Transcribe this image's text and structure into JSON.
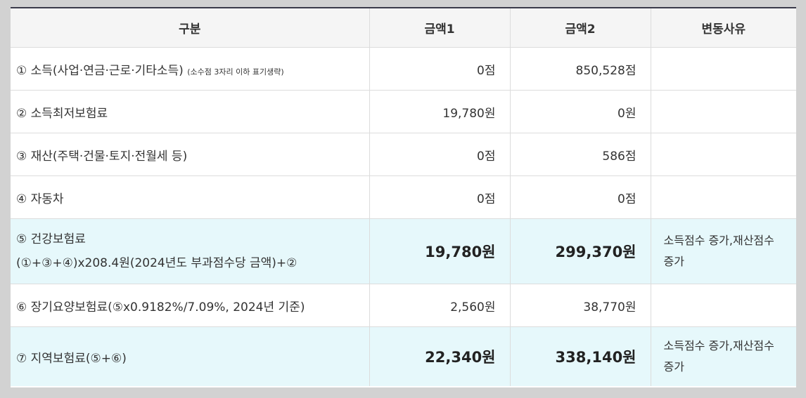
{
  "header": {
    "category": "구분",
    "amount1": "금액1",
    "amount2": "금액2",
    "reason": "변동사유"
  },
  "rows": [
    {
      "label": "① 소득(사업·연금·근로·기타소득)",
      "note": "(소수점 3자리 이하 표기생략)",
      "amount1": "0점",
      "amount2": "850,528점",
      "reason": ""
    },
    {
      "label": "② 소득최저보험료",
      "amount1": "19,780원",
      "amount2": "0원",
      "reason": ""
    },
    {
      "label": "③ 재산(주택·건물·토지·전월세 등)",
      "amount1": "0점",
      "amount2": "586점",
      "reason": ""
    },
    {
      "label": "④ 자동차",
      "amount1": "0점",
      "amount2": "0점",
      "reason": ""
    },
    {
      "label": "⑤ 건강보험료",
      "label2": "(①+③+④)x208.4원(2024년도 부과점수당 금액)+②",
      "amount1": "19,780원",
      "amount2": "299,370원",
      "reason": "소득점수 증가,재산점수 증가"
    },
    {
      "label": "⑥ 장기요양보험료(⑤x0.9182%/7.09%, 2024년 기준)",
      "amount1": "2,560원",
      "amount2": "38,770원",
      "reason": ""
    },
    {
      "label": "⑦ 지역보험료(⑤+⑥)",
      "amount1": "22,340원",
      "amount2": "338,140원",
      "reason": "소득점수 증가,재산점수 증가"
    }
  ],
  "colors": {
    "header_bg": "#f5f5f5",
    "highlight_bg": "#e6f8fb",
    "top_border": "#3b3b4a"
  }
}
